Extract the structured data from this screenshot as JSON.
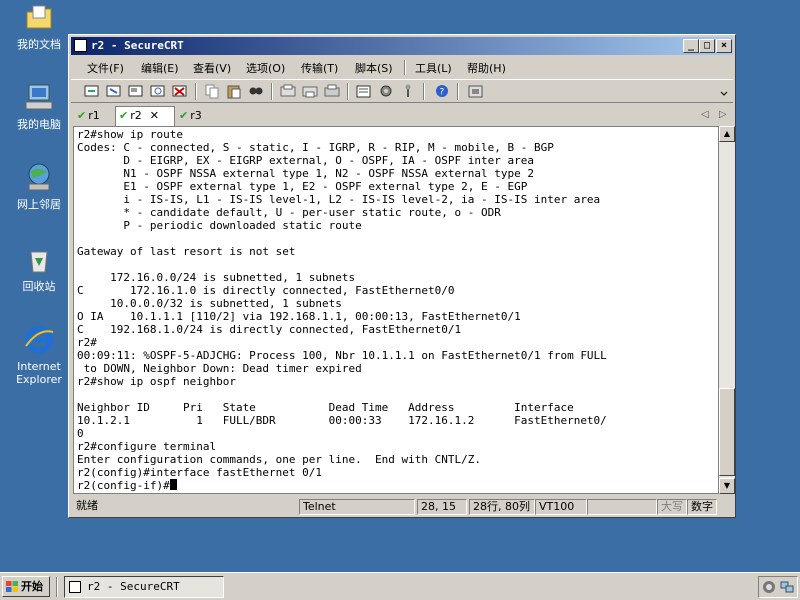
{
  "desktop": {
    "icons": [
      {
        "label": "我的文档"
      },
      {
        "label": "我的电脑"
      },
      {
        "label": "网上邻居"
      },
      {
        "label": "回收站"
      },
      {
        "label": "Internet Explorer"
      }
    ]
  },
  "window": {
    "title": "r2 - SecureCRT",
    "menu": [
      "文件(F)",
      "编辑(E)",
      "查看(V)",
      "选项(O)",
      "传输(T)",
      "脚本(S)",
      "工具(L)",
      "帮助(H)"
    ],
    "tabs": [
      {
        "label": "r1"
      },
      {
        "label": "r2"
      },
      {
        "label": "r3"
      }
    ],
    "terminal_lines": [
      "r2#show ip route",
      "Codes: C - connected, S - static, I - IGRP, R - RIP, M - mobile, B - BGP",
      "       D - EIGRP, EX - EIGRP external, O - OSPF, IA - OSPF inter area",
      "       N1 - OSPF NSSA external type 1, N2 - OSPF NSSA external type 2",
      "       E1 - OSPF external type 1, E2 - OSPF external type 2, E - EGP",
      "       i - IS-IS, L1 - IS-IS level-1, L2 - IS-IS level-2, ia - IS-IS inter area",
      "       * - candidate default, U - per-user static route, o - ODR",
      "       P - periodic downloaded static route",
      "",
      "Gateway of last resort is not set",
      "",
      "     172.16.0.0/24 is subnetted, 1 subnets",
      "C       172.16.1.0 is directly connected, FastEthernet0/0",
      "     10.0.0.0/32 is subnetted, 1 subnets",
      "O IA    10.1.1.1 [110/2] via 192.168.1.1, 00:00:13, FastEthernet0/1",
      "C    192.168.1.0/24 is directly connected, FastEthernet0/1",
      "r2#",
      "00:09:11: %OSPF-5-ADJCHG: Process 100, Nbr 10.1.1.1 on FastEthernet0/1 from FULL",
      " to DOWN, Neighbor Down: Dead timer expired",
      "r2#show ip ospf neighbor",
      "",
      "Neighbor ID     Pri   State           Dead Time   Address         Interface",
      "10.1.2.1          1   FULL/BDR        00:00:33    172.16.1.2      FastEthernet0/",
      "0",
      "r2#configure terminal",
      "Enter configuration commands, one per line.  End with CNTL/Z.",
      "r2(config)#interface fastEthernet 0/1"
    ],
    "prompt": "r2(config-if)#",
    "status": {
      "ready": "就绪",
      "protocol": "Telnet",
      "cursor_pos": "28, 15",
      "size": "28行, 80列",
      "emulation": "VT100",
      "caps": "大写",
      "num": "数字"
    }
  },
  "taskbar": {
    "start_label": "开始",
    "task_label": "r2 - SecureCRT"
  }
}
